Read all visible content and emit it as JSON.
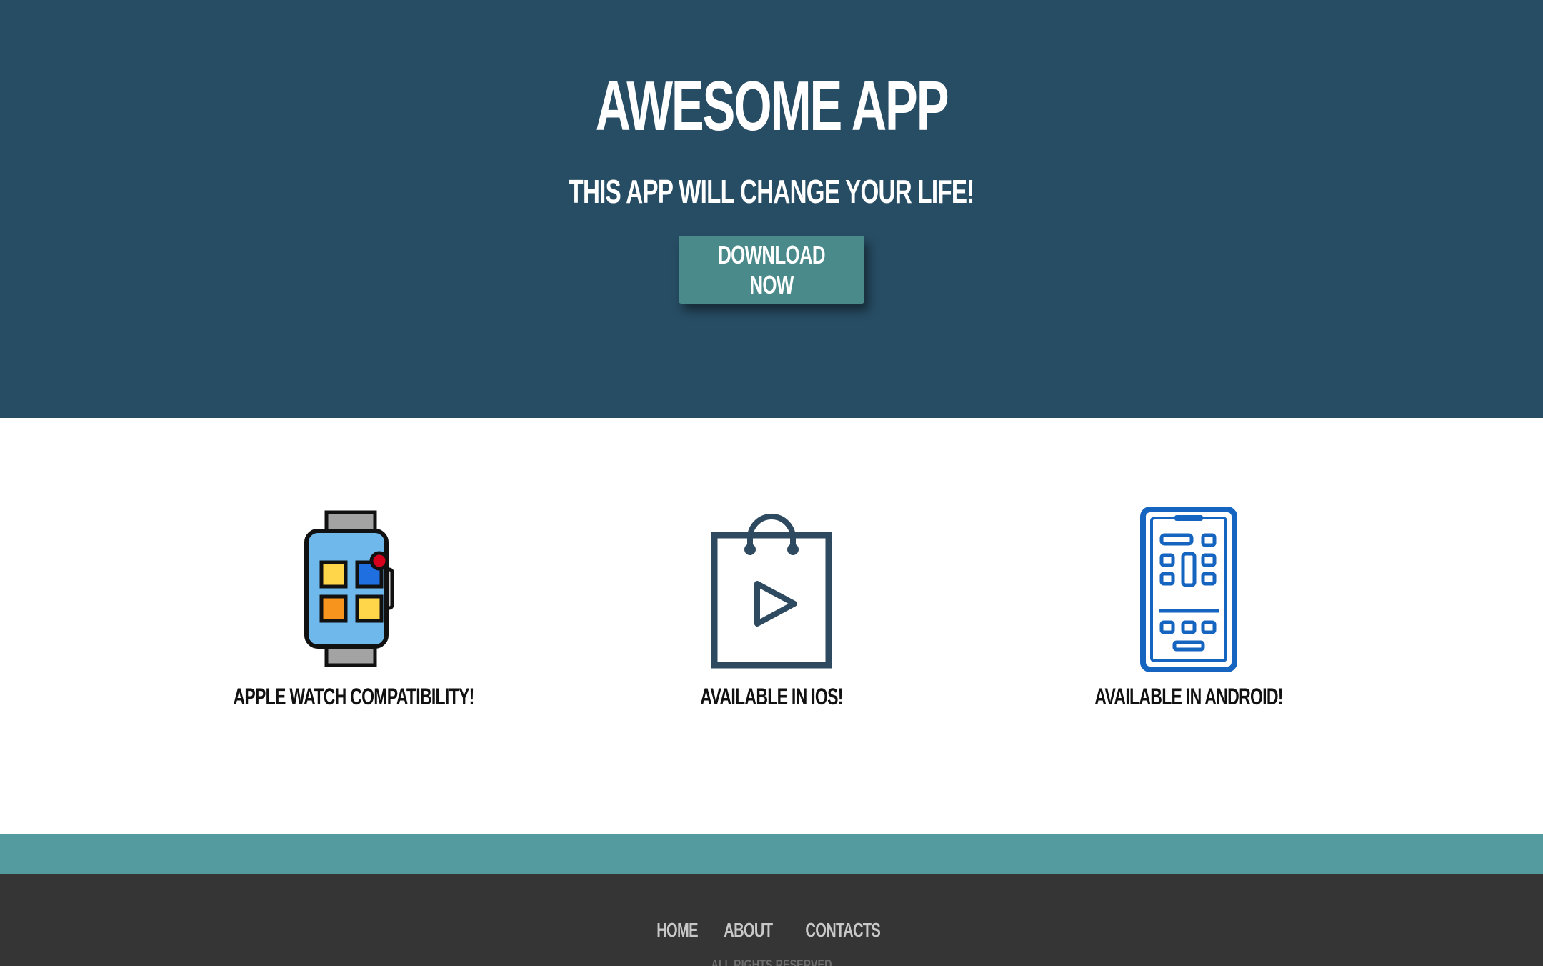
{
  "hero": {
    "title": "AWESOME APP",
    "tagline": "THIS APP WILL CHANGE YOUR LIFE!",
    "download_label": "DOWNLOAD NOW"
  },
  "features": [
    {
      "caption": "APPLE WATCH COMPATIBILITY!",
      "icon": "smartwatch-icon"
    },
    {
      "caption": "AVAILABLE IN IOS!",
      "icon": "shopping-bag-play-icon"
    },
    {
      "caption": "AVAILABLE IN ANDROID!",
      "icon": "smartphone-icon"
    }
  ],
  "footer": {
    "nav": [
      "HOME",
      "ABOUT",
      "CONTACTS"
    ],
    "copyright": "ALL RIGHTS RESERVED"
  },
  "colors": {
    "hero_bg": "#274d64",
    "button_bg": "#4a8a8a",
    "accent_bar": "#539b9e",
    "footer_bg": "#353535"
  }
}
